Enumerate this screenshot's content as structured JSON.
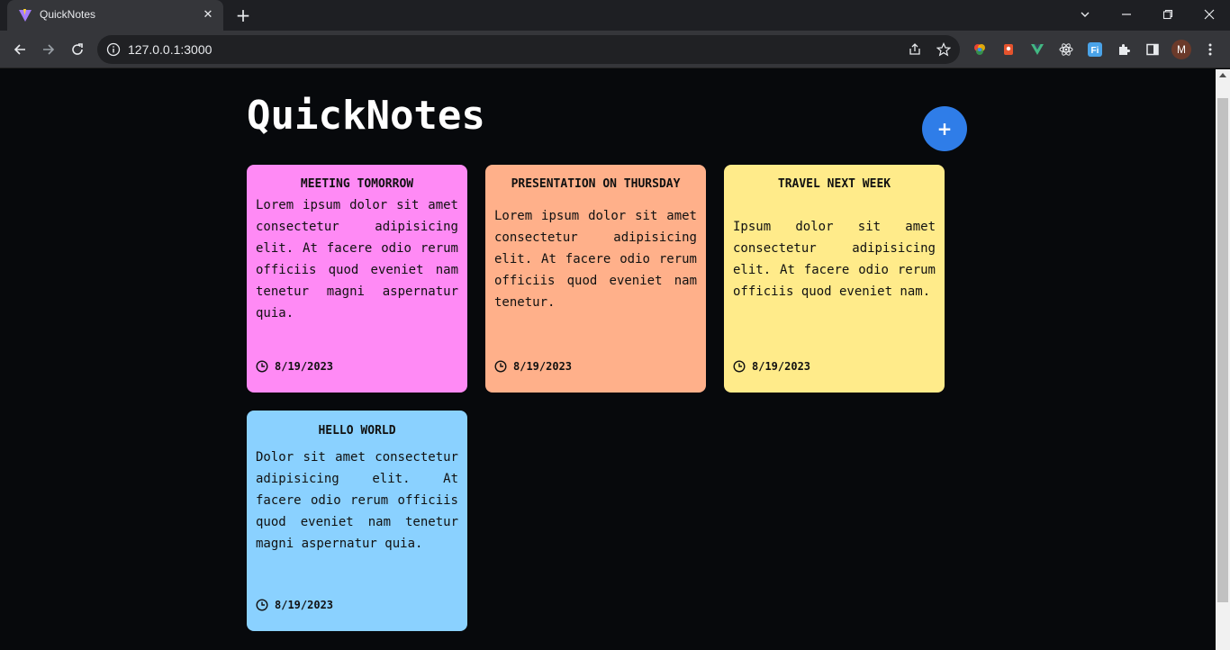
{
  "browser": {
    "tab_title": "QuickNotes",
    "url": "127.0.0.1:3000",
    "profile_initial": "M"
  },
  "app": {
    "title": "QuickNotes",
    "add_label": "+"
  },
  "notes": [
    {
      "title": "MEETING TOMORROW",
      "body": "Lorem ipsum dolor sit amet consectetur adipisicing elit. At facere odio rerum officiis quod eveniet nam tenetur magni aspernatur quia.",
      "date": "8/19/2023",
      "color": "#ff8af5"
    },
    {
      "title": "PRESENTATION ON THURSDAY",
      "body": "Lorem ipsum dolor sit amet consectetur adipisicing elit. At facere odio rerum officiis quod eveniet nam tenetur.",
      "date": "8/19/2023",
      "color": "#ffb08a"
    },
    {
      "title": "TRAVEL NEXT WEEK",
      "body": "Ipsum dolor sit amet consectetur adipisicing elit. At facere odio rerum officiis quod eveniet nam.",
      "date": "8/19/2023",
      "color": "#ffeb8a"
    },
    {
      "title": "HELLO WORLD",
      "body": "Dolor sit amet consectetur adipisicing elit. At facere odio rerum officiis quod eveniet nam tenetur magni aspernatur quia.",
      "date": "8/19/2023",
      "color": "#8ad1ff"
    }
  ]
}
